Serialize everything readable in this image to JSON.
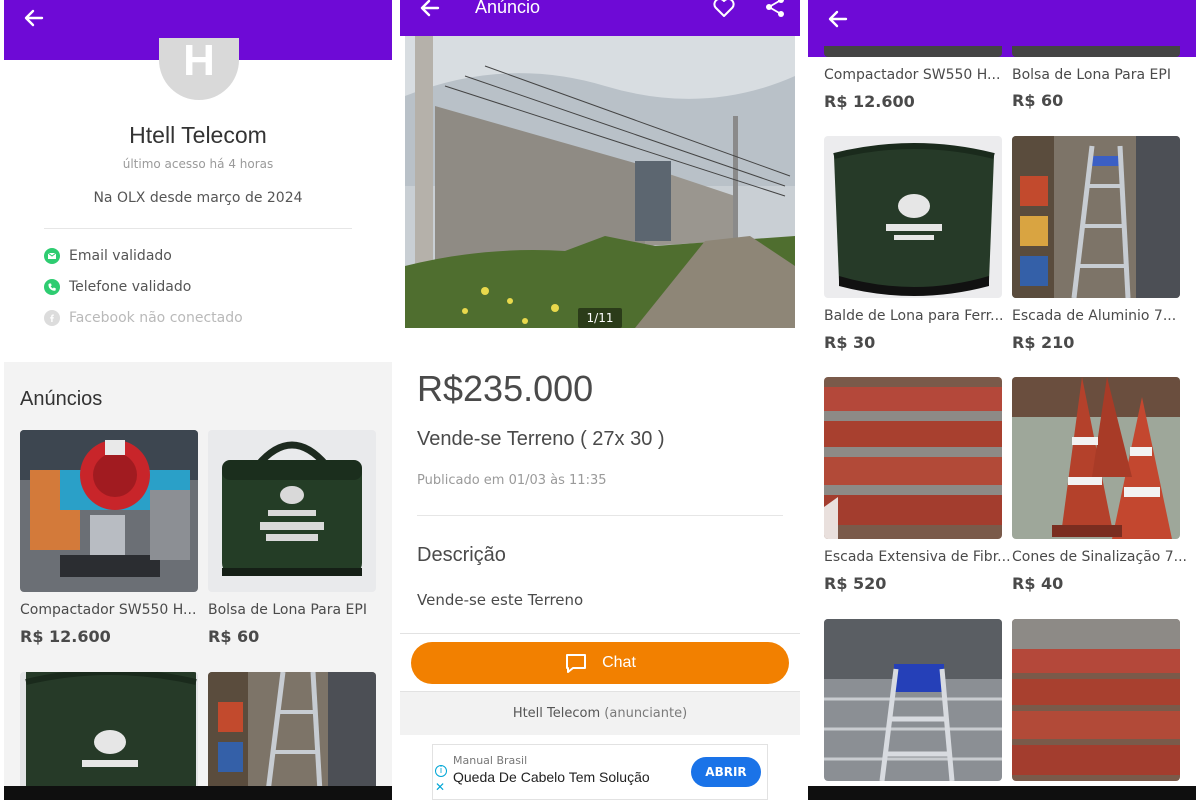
{
  "profile": {
    "avatar_letter": "H",
    "name": "Htell Telecom",
    "last_access": "último acesso há 4 horas",
    "member_since": "Na OLX desde março de 2024",
    "verifications": [
      {
        "label": "Email validado",
        "icon": "email-icon",
        "color": "#2ecc71"
      },
      {
        "label": "Telefone validado",
        "icon": "phone-icon",
        "color": "#2ecc71"
      },
      {
        "label": "Facebook não conectado",
        "icon": "facebook-icon",
        "color": "#d9d9d9"
      }
    ]
  },
  "ads_section": {
    "title": "Anúncios"
  },
  "listings": [
    {
      "name": "Compactador SW550 H...",
      "price": "R$ 12.600",
      "image": "compactor-photo"
    },
    {
      "name": "Bolsa de Lona Para EPI",
      "price": "R$ 60",
      "image": "green-bag-photo"
    },
    {
      "name": "Balde de Lona para Ferr...",
      "price": "R$ 30",
      "image": "canvas-bucket-photo"
    },
    {
      "name": "Escada de Aluminio 7...",
      "price": "R$ 210",
      "image": "aluminum-ladder-photo"
    },
    {
      "name": "Escada Extensiva de Fibr...",
      "price": "R$ 520",
      "image": "extension-ladder-photo"
    },
    {
      "name": "Cones de Sinalização 7...",
      "price": "R$ 40",
      "image": "traffic-cones-photo"
    }
  ],
  "ad_detail": {
    "header_title": "Anúncio",
    "photo_counter": "1/11",
    "price": "R$235.000",
    "title": "Vende-se Terreno ( 27x 30 )",
    "published": "Publicado em 01/03 às 11:35",
    "description_title": "Descrição",
    "description": "Vende-se este Terreno",
    "chat_label": "Chat",
    "seller_name": "Htell Telecom",
    "seller_role": "(anunciante)"
  },
  "banner_ad": {
    "brand": "Manual Brasil",
    "headline": "Queda De Cabelo Tem Solução",
    "button": "ABRIR"
  },
  "colors": {
    "brand_purple": "#6e0ad6",
    "chat_orange": "#f28000",
    "verified_green": "#2ecc71"
  }
}
